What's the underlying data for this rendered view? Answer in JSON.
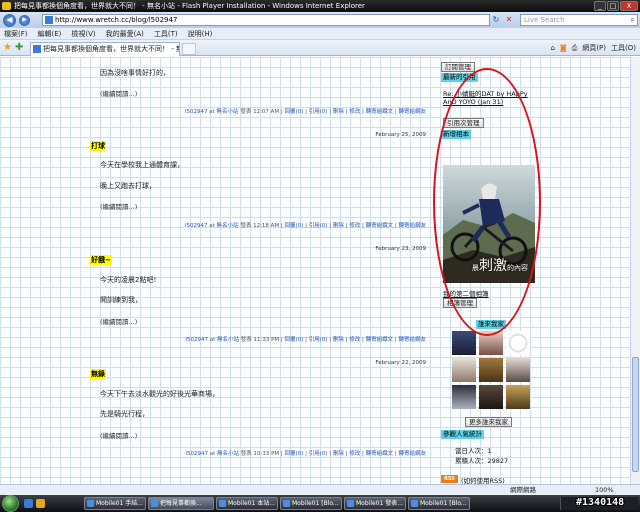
{
  "window": {
    "title": "把每見事都換個角度看，世界就大不同！ - 無名小站 - Flash Player Installation - Windows Internet Explorer",
    "minimize": "_",
    "maximize": "□",
    "close": "X"
  },
  "addressbar": {
    "back": "◀",
    "forward": "▶",
    "url": "http://www.wretch.cc/blog/l502947",
    "search_placeholder": "Live Search"
  },
  "menu": [
    "檔案(F)",
    "編輯(E)",
    "檢視(V)",
    "我的最愛(A)",
    "工具(T)",
    "說明(H)"
  ],
  "tab": {
    "label": "把每見事都換個角度看，世界就大不同！ - 無名小..."
  },
  "commands": {
    "page": "網頁(P)",
    "tools": "工具(O)"
  },
  "posts": [
    {
      "lines": [
        "因為沒啥事情好打的，"
      ],
      "read_more": "(繼續閱讀...)",
      "meta": {
        "author": "l502947",
        "at": "at",
        "site": "無名小站",
        "time": "12:07 AM",
        "verb": "發表",
        "reply": "回覆(0)",
        "trackback": "引用(0)",
        "delete": "刪除",
        "edit": "修改",
        "editor": "轉寄組織文",
        "group": "轉寄給網友"
      }
    },
    {
      "date": "February 25, 2009",
      "title": "打球",
      "lines": [
        "今天在學校我上通體育課，",
        "晚上又跑去打球，"
      ],
      "read_more": "(繼續閱讀...)",
      "meta": {
        "author": "l502947",
        "at": "at",
        "site": "無名小站",
        "time": "12:18 AM",
        "verb": "發表",
        "reply": "回覆(0)",
        "trackback": "引用(0)",
        "delete": "刪除",
        "edit": "修改",
        "editor": "轉寄組織文",
        "group": "轉寄給網友"
      }
    },
    {
      "date": "February 23, 2009",
      "title": "好餓~",
      "lines": [
        "今天的凌晨2點吧!",
        "開訓練到我，"
      ],
      "read_more": "(繼續閱讀...)",
      "meta": {
        "author": "l502947",
        "at": "at",
        "site": "無名小站",
        "time": "11:33 PM",
        "verb": "發表",
        "reply": "回覆(0)",
        "trackback": "引用(0)",
        "delete": "刪除",
        "edit": "修改",
        "editor": "轉寄組織文",
        "group": "轉寄給網友"
      }
    },
    {
      "date": "February 22, 2009",
      "title": "無錄",
      "lines": [
        "今天下午去淡水觀光的好後光華商場，",
        "先是騎光行程，"
      ],
      "read_more": "(繼續閱讀...)",
      "meta": {
        "author": "l502947",
        "at": "at",
        "site": "無名小站",
        "time": "10:33 PM",
        "verb": "發表",
        "reply": "回覆(0)",
        "trackback": "引用(0)",
        "delete": "刪除",
        "edit": "修改",
        "editor": "轉寄組織文",
        "group": "轉寄給網友"
      }
    }
  ],
  "sidebar": {
    "subscribe_btn": "訂閱管理",
    "recent_refs_head": "最新的引用",
    "recent_ref_link_1": "Re: 小蜻蜓的DAT by HApPy",
    "recent_ref_link_2": "AnD YOYO (Jan 31)",
    "ref_manage_btn": "引用次管理",
    "new_album_head": "新增相本",
    "photo_caption_small_1": "晨",
    "photo_caption_big": "刺激",
    "photo_caption_small_2": "的內容",
    "album_link": "我的第二個相簿",
    "album_manage_btn": "相簿管理",
    "friends_head": "誰來我家",
    "more_friends_btn": "更多誰來我家",
    "stats_head": "參觀人氣統計",
    "today_label": "當日人次：",
    "today_value": "1",
    "total_label": "累積人次：",
    "total_value": "29827",
    "rss_badge": "RSS",
    "rss_help": "(如何使用RSS)"
  },
  "statusbar": {
    "zone": "網際網路",
    "zoom": "100%"
  },
  "taskbar": {
    "items": [
      {
        "label": "Mobile01 手結..."
      },
      {
        "label": "把每見事都換..."
      },
      {
        "label": "Mobile01 本站..."
      },
      {
        "label": "Mobile01 [Blo..."
      },
      {
        "label": "Mobile01 發表..."
      },
      {
        "label": "Mobile01 [Blo..."
      }
    ]
  },
  "watermark": "#1340148",
  "colors": {
    "highlight": "#ffff00",
    "sidebar_head": "#5ed1e6",
    "annotation": "#d7131b",
    "link": "#2a56b8"
  }
}
